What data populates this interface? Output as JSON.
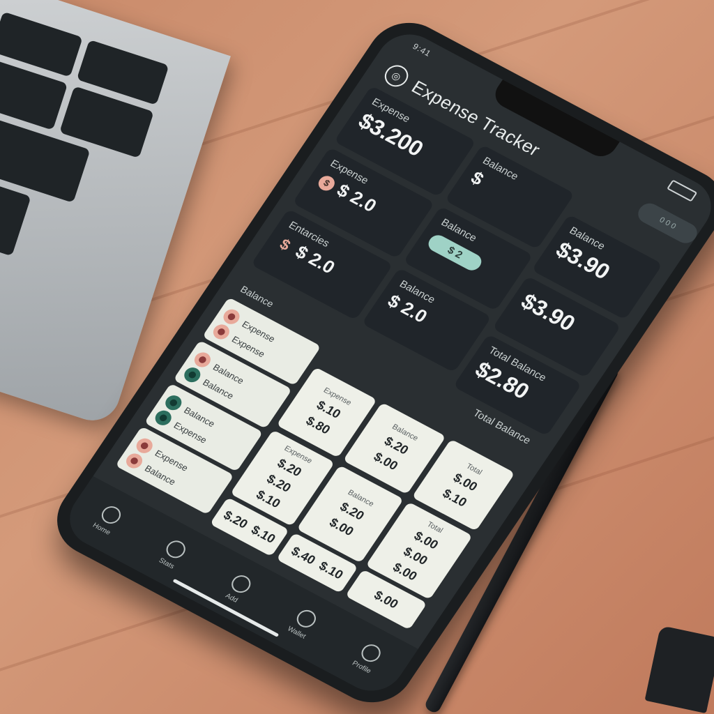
{
  "status": {
    "time": "9:41"
  },
  "header": {
    "title": "Expense Tracker",
    "pill": "0 0 0"
  },
  "cards": [
    {
      "label": "Expense",
      "value": "$3.200"
    },
    {
      "label": "Expense",
      "value": "$ 2.0"
    },
    {
      "label": "Entarcies",
      "value": "$ 2.0"
    },
    {
      "label": "Balance",
      "value": "$"
    },
    {
      "label": "Balance",
      "value": "$ 2"
    },
    {
      "label": "Balance",
      "value": "$ 2.0"
    },
    {
      "label": "Balance",
      "value": "$3.90"
    },
    {
      "label": "",
      "value": "$3.90"
    },
    {
      "label": "Total Balance",
      "value": "$2.80"
    }
  ],
  "sections": {
    "balance_label": "Balance",
    "total_label": "Total Balance"
  },
  "transactions": {
    "rows": [
      {
        "items": [
          {
            "name": "Expense",
            "color": "#e8a99a"
          },
          {
            "name": "Expense",
            "color": "#e8a99a"
          }
        ]
      },
      {
        "items": [
          {
            "name": "Balance",
            "color": "#e8a99a"
          },
          {
            "name": "Balance",
            "color": "#2c6e5e"
          }
        ]
      },
      {
        "items": [
          {
            "name": "Balance",
            "color": "#2c6e5e"
          },
          {
            "name": "Expense",
            "color": "#2c6e5e"
          }
        ]
      },
      {
        "items": [
          {
            "name": "Expense",
            "color": "#e8a99a"
          },
          {
            "name": "Balance",
            "color": "#e8a99a"
          }
        ]
      }
    ],
    "columns": [
      {
        "head": "Expense",
        "amounts": [
          "$.10",
          "$.80"
        ]
      },
      {
        "head": "Balance",
        "amounts": [
          "$.20",
          "$.00"
        ]
      },
      {
        "head": "Total",
        "amounts": [
          "$.00",
          "$.10"
        ]
      }
    ],
    "lower_columns": [
      {
        "head": "Expense",
        "amounts": [
          "$.20",
          "$.20",
          "$.10"
        ]
      },
      {
        "head": "Balance",
        "amounts": [
          "$.20",
          "$.00"
        ]
      },
      {
        "head": "Total",
        "amounts": [
          "$.00",
          "$.00",
          "$.00"
        ]
      }
    ],
    "bottom_cells": [
      {
        "amounts": [
          "$.20",
          "$.10"
        ]
      },
      {
        "amounts": [
          "$.40",
          "$.10"
        ]
      },
      {
        "amounts": [
          "$.00"
        ]
      }
    ]
  },
  "nav": [
    {
      "label": "Home",
      "icon": "home-icon"
    },
    {
      "label": "Stats",
      "icon": "chart-icon"
    },
    {
      "label": "Add",
      "icon": "add-icon"
    },
    {
      "label": "Wallet",
      "icon": "wallet-icon"
    },
    {
      "label": "Profile",
      "icon": "profile-icon"
    }
  ],
  "colors": {
    "accent_mint": "#9fd2c6",
    "accent_coral": "#e8a99a",
    "screen_bg": "#2a2f32",
    "card_bg": "#20252a"
  }
}
